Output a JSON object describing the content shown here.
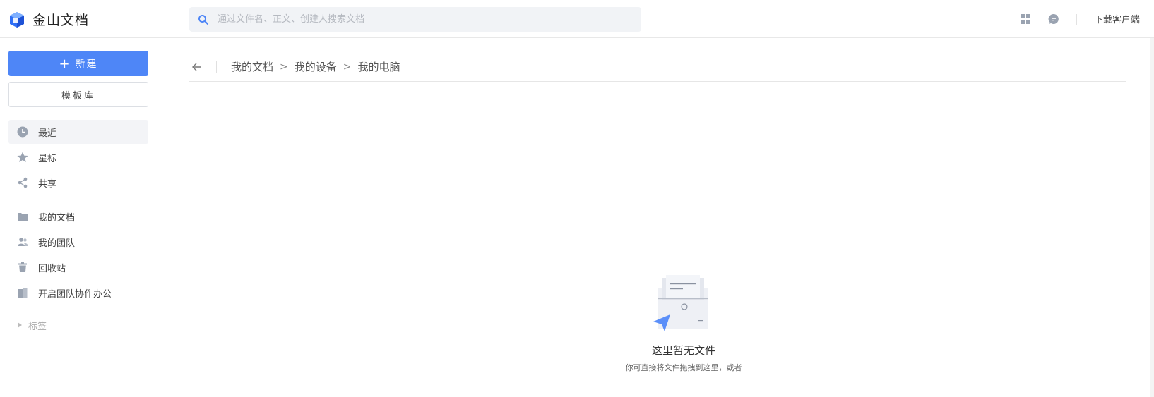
{
  "app": {
    "logo_text": "金山文档",
    "brand_color": "#4e86f7"
  },
  "header": {
    "search_placeholder": "通过文件名、正文、创建人搜索文档",
    "download_label": "下载客户端"
  },
  "sidebar": {
    "new_label": "新建",
    "template_label": "模板库",
    "items": [
      {
        "label": "最近",
        "icon": "clock-icon",
        "active": true
      },
      {
        "label": "星标",
        "icon": "star-icon"
      },
      {
        "label": "共享",
        "icon": "share-icon"
      },
      {
        "label": "我的文档",
        "icon": "folder-icon"
      },
      {
        "label": "我的团队",
        "icon": "team-icon"
      },
      {
        "label": "回收站",
        "icon": "trash-icon"
      },
      {
        "label": "开启团队协作办公",
        "icon": "building-icon"
      }
    ],
    "tags_label": "标签"
  },
  "breadcrumb": [
    "我的文档",
    "我的设备",
    "我的电脑"
  ],
  "empty_state": {
    "title": "这里暂无文件",
    "subtitle": "你可直接将文件拖拽到这里，或者"
  }
}
